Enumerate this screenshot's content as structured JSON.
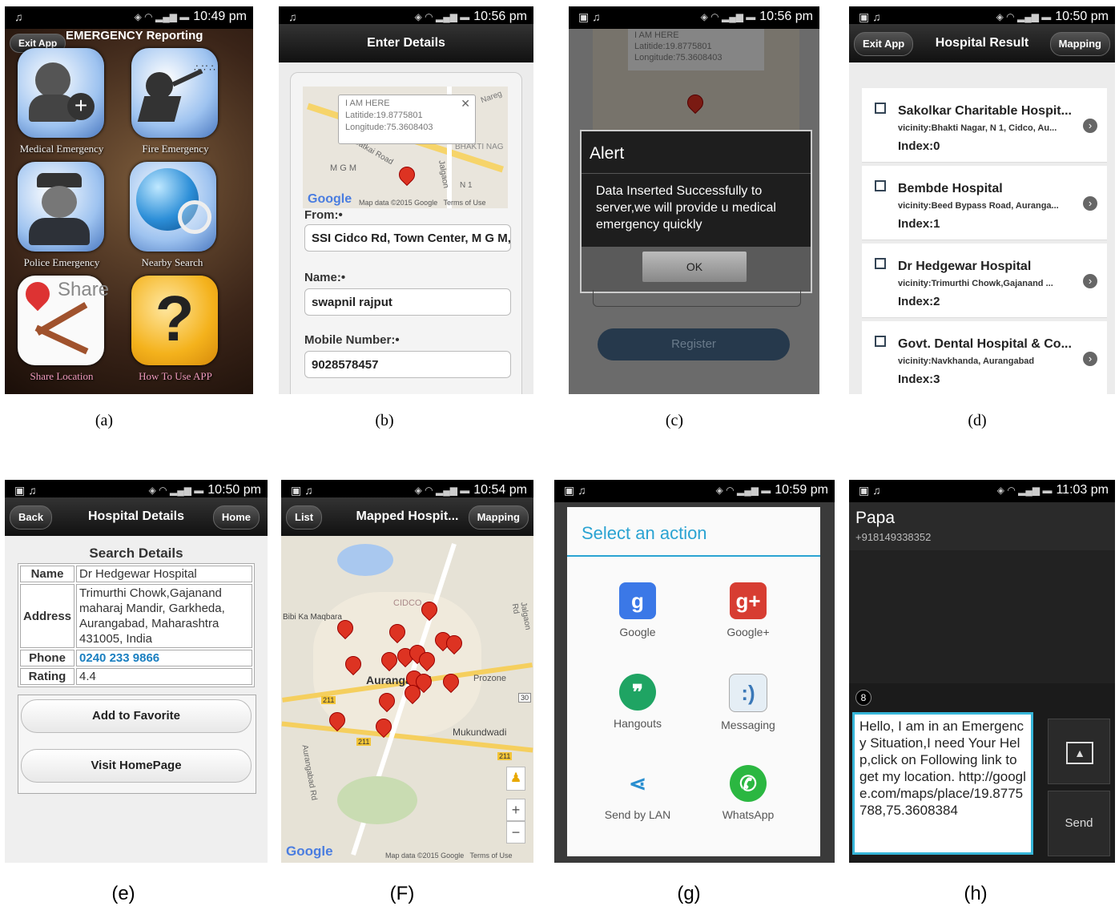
{
  "captions": [
    "(a)",
    "(b)",
    "(c)",
    "(d)",
    "(e)",
    "(F)",
    "(g)",
    "(h)"
  ],
  "times": {
    "a": "10:49 pm",
    "b": "10:56 pm",
    "c": "10:56 pm",
    "d": "10:50 pm",
    "e": "10:50 pm",
    "f": "10:54 pm",
    "g": "10:59 pm",
    "h": "11:03 pm"
  },
  "panel_a": {
    "exit_label": "Exit App",
    "title": "EMERGENCY Reporting",
    "tiles": [
      "Medical Emergency",
      "Fire Emergency",
      "Police Emergency",
      "Nearby Search",
      "Share Location",
      "How To Use APP"
    ],
    "share_word": "Share"
  },
  "panel_b": {
    "title": "Enter Details",
    "bubble_title": "I AM HERE",
    "bubble_lat": "Latitide:19.8775801",
    "bubble_lon": "Longitude:75.3608403",
    "map_labels": [
      "Nareg",
      "BHAKTI NAG",
      "M G M",
      "Gatkai Road",
      "Jalgaon",
      "N 1"
    ],
    "google": "Google",
    "map_footer": "Map data ©2015 Google   Terms of Use",
    "from_label": "From:•",
    "from_value": "SSI Cidco Rd, Town Center, M G M,",
    "name_label": "Name:•",
    "name_value": "swapnil rajput",
    "mobile_label": "Mobile Number:•",
    "mobile_value": "9028578457"
  },
  "panel_c": {
    "bubble_title": "I AM HERE",
    "bubble_lat": "Latitide:19.8775801",
    "bubble_lon": "Longitude:75.3608403",
    "alert_title": "Alert",
    "alert_msg": "Data Inserted Successfully to server,we will provide u medical emergency quickly",
    "ok": "OK",
    "register": "Register"
  },
  "panel_d": {
    "exit": "Exit App",
    "title": "Hospital Result",
    "mapping": "Mapping",
    "items": [
      {
        "name": "Sakolkar Charitable Hospit...",
        "vicinity": "vicinity:Bhakti Nagar, N 1, Cidco, Au...",
        "index": "Index:0"
      },
      {
        "name": "Bembde Hospital",
        "vicinity": "vicinity:Beed Bypass Road, Auranga...",
        "index": "Index:1"
      },
      {
        "name": "Dr Hedgewar Hospital",
        "vicinity": "vicinity:Trimurthi Chowk,Gajanand ...",
        "index": "Index:2"
      },
      {
        "name": "Govt. Dental Hospital & Co...",
        "vicinity": "vicinity:Navkhanda, Aurangabad",
        "index": "Index:3"
      }
    ]
  },
  "panel_e": {
    "back": "Back",
    "title": "Hospital Details",
    "home": "Home",
    "heading": "Search Details",
    "rows": [
      {
        "k": "Name",
        "v": "Dr Hedgewar Hospital"
      },
      {
        "k": "Address",
        "v": "Trimurthi Chowk,Gajanand maharaj Mandir, Garkheda, Aurangabad, Maharashtra 431005, India"
      },
      {
        "k": "Phone",
        "v": "0240 233 9866"
      },
      {
        "k": "Rating",
        "v": "4.4"
      }
    ],
    "fav": "Add to Favorite",
    "visit": "Visit HomePage"
  },
  "panel_f": {
    "list": "List",
    "title": "Mapped Hospit...",
    "mapping": "Mapping",
    "labels": {
      "cidco": "CIDCO",
      "maqbara": "Bibi Ka Maqbara",
      "aurangabad": "Aurangabad",
      "prozone": "Prozone",
      "mukundwadi": "Mukundwadi",
      "jalgaon": "Jalgaon Rd",
      "aurangabad_rd": "Aurangabad Rd",
      "r211a": "211",
      "r211b": "211",
      "r211c": "211",
      "r30": "30",
      "plus": "+",
      "minus": "−"
    },
    "google": "Google",
    "footer": "Map data ©2015 Google   Terms of Use"
  },
  "panel_g": {
    "title": "Select an action",
    "apps": [
      "Google",
      "Google+",
      "Hangouts",
      "Messaging",
      "Send by LAN",
      "WhatsApp"
    ]
  },
  "panel_h": {
    "contact": "Papa",
    "number": "+918149338352",
    "count": "8",
    "message": "Hello, I am in an Emergency Situation,I need Your Help,click on Following link to get my location.   http://google.com/maps/place/19.8775788,75.3608384",
    "send": "Send"
  }
}
